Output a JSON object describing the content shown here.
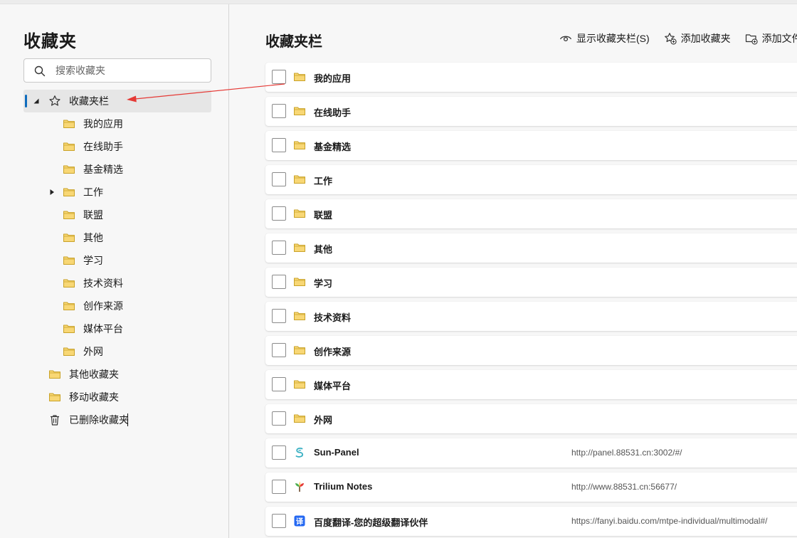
{
  "sidebar": {
    "title": "收藏夹",
    "search": {
      "placeholder": "搜索收藏夹",
      "value": ""
    },
    "tree": [
      {
        "label": "收藏夹栏",
        "level": 0,
        "icon": "star-icon",
        "expanded": true,
        "selected": true
      },
      {
        "label": "我的应用",
        "level": 1,
        "icon": "folder-icon"
      },
      {
        "label": "在线助手",
        "level": 1,
        "icon": "folder-icon"
      },
      {
        "label": "基金精选",
        "level": 1,
        "icon": "folder-icon"
      },
      {
        "label": "工作",
        "level": 1,
        "icon": "folder-icon",
        "collapsed_caret": true
      },
      {
        "label": "联盟",
        "level": 1,
        "icon": "folder-icon"
      },
      {
        "label": "其他",
        "level": 1,
        "icon": "folder-icon"
      },
      {
        "label": "学习",
        "level": 1,
        "icon": "folder-icon"
      },
      {
        "label": "技术资料",
        "level": 1,
        "icon": "folder-icon"
      },
      {
        "label": "创作来源",
        "level": 1,
        "icon": "folder-icon"
      },
      {
        "label": "媒体平台",
        "level": 1,
        "icon": "folder-icon"
      },
      {
        "label": "外网",
        "level": 1,
        "icon": "folder-icon"
      },
      {
        "label": "其他收藏夹",
        "level": 0,
        "icon": "folder-icon"
      },
      {
        "label": "移动收藏夹",
        "level": 0,
        "icon": "folder-icon"
      },
      {
        "label": "已删除收藏夹",
        "level": 0,
        "icon": "trash-icon"
      }
    ]
  },
  "main": {
    "title": "收藏夹栏",
    "toolbar": {
      "show_bar": "显示收藏夹栏(S)",
      "add_favorite": "添加收藏夹",
      "add_folder": "添加文件"
    },
    "items": [
      {
        "label": "我的应用",
        "type": "folder",
        "url": ""
      },
      {
        "label": "在线助手",
        "type": "folder",
        "url": ""
      },
      {
        "label": "基金精选",
        "type": "folder",
        "url": ""
      },
      {
        "label": "工作",
        "type": "folder",
        "url": ""
      },
      {
        "label": "联盟",
        "type": "folder",
        "url": ""
      },
      {
        "label": "其他",
        "type": "folder",
        "url": ""
      },
      {
        "label": "学习",
        "type": "folder",
        "url": ""
      },
      {
        "label": "技术资料",
        "type": "folder",
        "url": ""
      },
      {
        "label": "创作来源",
        "type": "folder",
        "url": ""
      },
      {
        "label": "媒体平台",
        "type": "folder",
        "url": ""
      },
      {
        "label": "外网",
        "type": "folder",
        "url": ""
      },
      {
        "label": "Sun-Panel",
        "type": "sun-panel",
        "url": "http://panel.88531.cn:3002/#/"
      },
      {
        "label": "Trilium Notes",
        "type": "trilium",
        "url": "http://www.88531.cn:56677/"
      },
      {
        "label": "百度翻译-您的超级翻译伙伴",
        "type": "baidu-translate",
        "url": "https://fanyi.baidu.com/mtpe-individual/multimodal#/"
      }
    ]
  },
  "colors": {
    "accent": "#0f6cbd",
    "folder_fill": "#f8d775",
    "folder_stroke": "#c9a227",
    "annotation_arrow": "#e53935"
  }
}
